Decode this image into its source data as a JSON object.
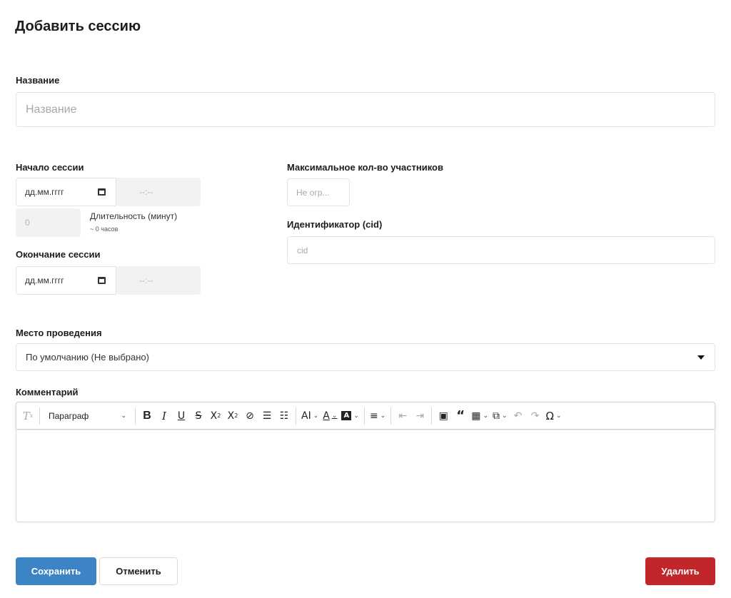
{
  "title": "Добавить сессию",
  "name": {
    "label": "Название",
    "placeholder": "Название",
    "value": ""
  },
  "start": {
    "label": "Начало сессии",
    "date_placeholder": "дд.мм.гггг",
    "time_placeholder": "--:--"
  },
  "duration": {
    "value": "0",
    "label": "Длительность (минут)",
    "hint": "~ 0 часов"
  },
  "end": {
    "label": "Окончание сессии",
    "date_placeholder": "дд.мм.гггг",
    "time_placeholder": "--:--"
  },
  "max_participants": {
    "label": "Максимальное кол-во участников",
    "placeholder": "Не огр..."
  },
  "cid": {
    "label": "Идентификатор (cid)",
    "placeholder": "cid"
  },
  "venue": {
    "label": "Место проведения",
    "selected": "По умолчанию (Не выбрано)"
  },
  "comment": {
    "label": "Комментарий",
    "toolbar": {
      "paragraph": "Параграф",
      "icons": [
        "clear-formatting-icon",
        "bold-icon",
        "italic-icon",
        "underline-icon",
        "strikethrough-icon",
        "subscript-icon",
        "superscript-icon",
        "link-icon",
        "bulleted-list-icon",
        "numbered-list-icon",
        "font-size-icon",
        "font-color-icon",
        "highlight-icon",
        "align-icon",
        "outdent-icon",
        "indent-icon",
        "image-icon",
        "quote-icon",
        "table-icon",
        "html-embed-icon",
        "undo-icon",
        "redo-icon",
        "special-characters-icon"
      ]
    },
    "value": ""
  },
  "buttons": {
    "save": "Сохранить",
    "cancel": "Отменить",
    "delete": "Удалить"
  },
  "colors": {
    "primary": "#3d84c6",
    "danger": "#c0262a",
    "muted_field": "#f2f2f2"
  }
}
